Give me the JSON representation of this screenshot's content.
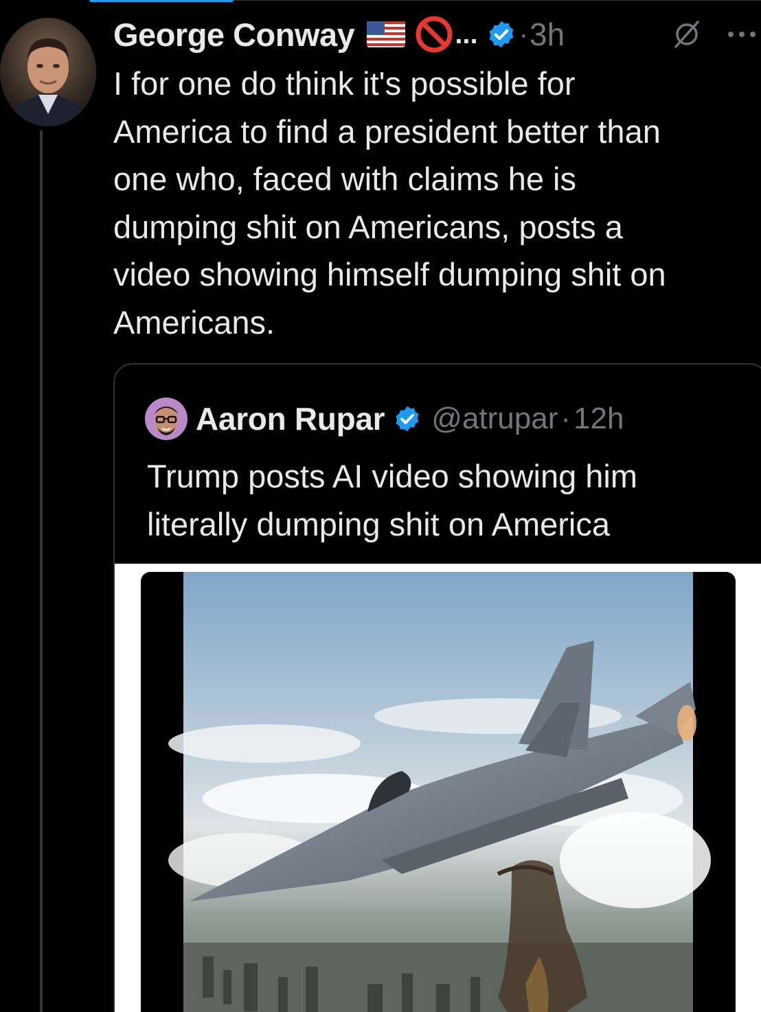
{
  "tweet": {
    "author_name": "George Conway",
    "name_overflow": "...",
    "time_separator": "·",
    "time": "3h",
    "text_lines": [
      "I for one do think it's possible for",
      "America to find a president better than",
      "one who, faced with claims he is",
      "dumping shit on Americans, posts a",
      "video showing himself dumping shit on",
      "Americans."
    ],
    "icons": {
      "flag": "us-flag-icon",
      "no_entry": "no-entry-icon",
      "verified": "verified-badge-icon",
      "grok": "grok-icon",
      "more": "more-icon"
    }
  },
  "quote": {
    "author_name": "Aaron Rupar",
    "handle": "@atrupar",
    "time_separator": "·",
    "time": "12h",
    "text_lines": [
      "Trump posts AI video showing him",
      "literally dumping shit on America"
    ]
  },
  "colors": {
    "background": "#000000",
    "text_primary": "#e7e9ea",
    "text_secondary": "#71767b",
    "verified_blue": "#1d9bf0",
    "border": "#2f3336"
  }
}
